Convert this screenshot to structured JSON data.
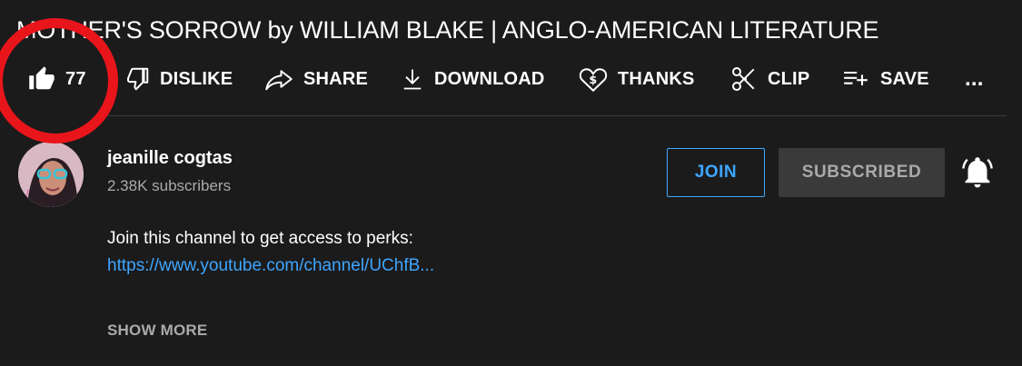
{
  "video": {
    "title": "MOTHER'S SORROW by WILLIAM BLAKE | ANGLO-AMERICAN LITERATURE"
  },
  "actions": {
    "like_count": "77",
    "dislike_label": "DISLIKE",
    "share_label": "SHARE",
    "download_label": "DOWNLOAD",
    "thanks_label": "THANKS",
    "clip_label": "CLIP",
    "save_label": "SAVE",
    "more_label": "..."
  },
  "channel": {
    "name": "jeanille cogtas",
    "subscribers": "2.38K subscribers",
    "join_label": "JOIN",
    "subscribed_label": "SUBSCRIBED"
  },
  "description": {
    "line": "Join this channel to get access to perks:",
    "link": "https://www.youtube.com/channel/UChfB...",
    "show_more_label": "SHOW MORE"
  },
  "colors": {
    "background": "#1b1b1b",
    "accent_link": "#3ea6ff",
    "annotation_ring": "#e8151b"
  },
  "icons": [
    "like-icon",
    "dislike-icon",
    "share-icon",
    "download-icon",
    "thanks-icon",
    "clip-icon",
    "save-icon",
    "more-icon",
    "bell-icon"
  ]
}
